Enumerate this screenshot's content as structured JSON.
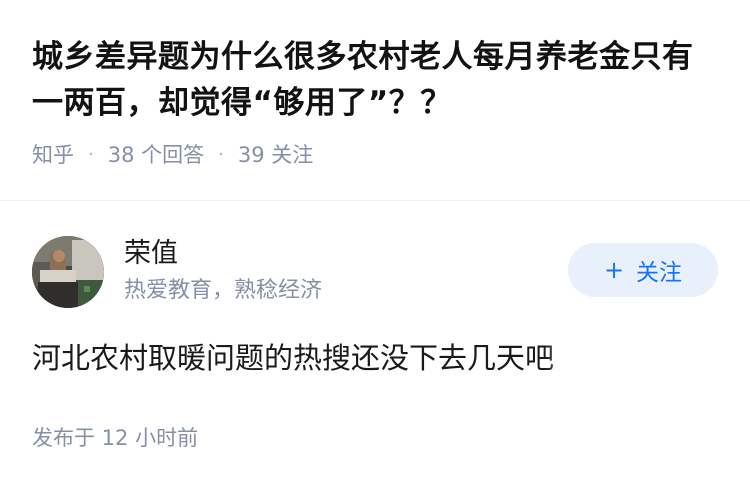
{
  "question": {
    "title": "城乡差异题为什么很多农村老人每月养老金只有一两百，却觉得“够用了”？？",
    "meta": {
      "source": "知乎",
      "answers": "38 个回答",
      "followers": "39 关注"
    }
  },
  "author": {
    "name": "荣值",
    "bio": "热爱教育，熟稔经济",
    "follow_label": "关注",
    "follow_icon": "plus-icon"
  },
  "answer": {
    "excerpt": "河北农村取暖问题的热搜还没下去几天吧",
    "published": "发布于 12 小时前"
  },
  "colors": {
    "accent": "#1772f6",
    "follow_bg": "#e8f0fb",
    "meta_text": "#8590a6",
    "title_text": "#121212"
  }
}
